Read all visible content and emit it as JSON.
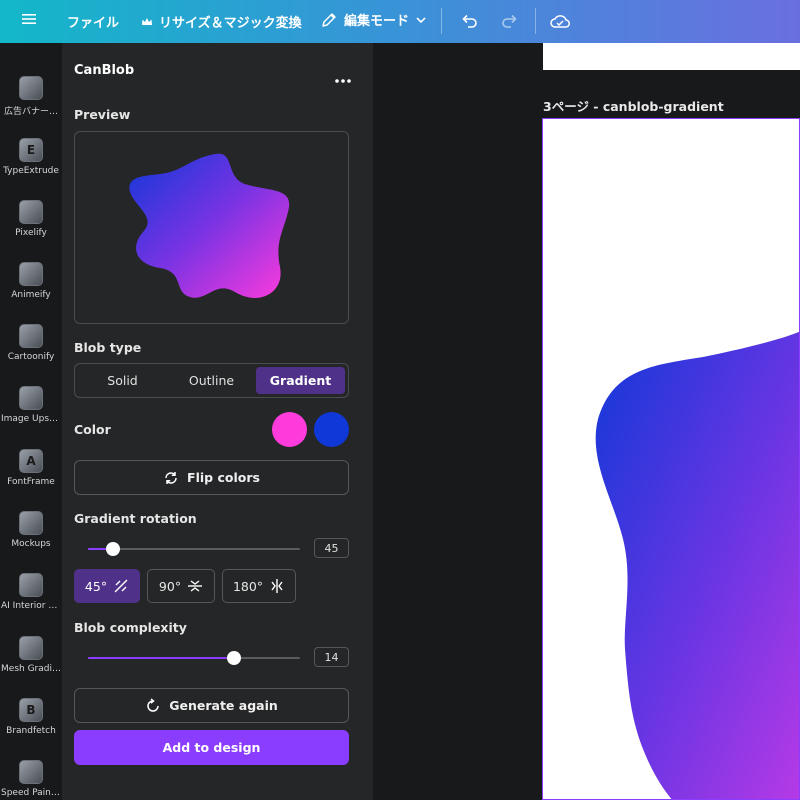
{
  "topbar": {
    "file_label": "ファイル",
    "resize_label": "リサイズ＆マジック変換",
    "edit_mode_label": "編集モード"
  },
  "apps": [
    {
      "label": "広告バナー…",
      "glyph": ""
    },
    {
      "label": "TypeExtrude",
      "glyph": "E"
    },
    {
      "label": "Pixelify",
      "glyph": ""
    },
    {
      "label": "Animeify",
      "glyph": ""
    },
    {
      "label": "Cartoonify",
      "glyph": ""
    },
    {
      "label": "Image Upsc…",
      "glyph": ""
    },
    {
      "label": "FontFrame",
      "glyph": "A"
    },
    {
      "label": "Mockups",
      "glyph": ""
    },
    {
      "label": "AI Interior S…",
      "glyph": ""
    },
    {
      "label": "Mesh Gradi…",
      "glyph": ""
    },
    {
      "label": "Brandfetch",
      "glyph": "B"
    },
    {
      "label": "Speed Paint…",
      "glyph": ""
    }
  ],
  "panel": {
    "title": "CanBlob",
    "preview_label": "Preview",
    "blob_type_label": "Blob type",
    "blob_types": [
      "Solid",
      "Outline",
      "Gradient"
    ],
    "blob_type_selected": "Gradient",
    "color_label": "Color",
    "flip_colors_label": "Flip colors",
    "gradient_rotation_label": "Gradient rotation",
    "gradient_rotation_value": "45",
    "gradient_rotation_fraction": 0.12,
    "rotation_presets": [
      "45°",
      "90°",
      "180°"
    ],
    "rotation_selected": "45°",
    "blob_complexity_label": "Blob complexity",
    "blob_complexity_value": "14",
    "blob_complexity_fraction": 0.69,
    "generate_again_label": "Generate again",
    "add_to_design_label": "Add to design"
  },
  "colors": {
    "gradient_start": "#ff3bdc",
    "gradient_end": "#1038d8",
    "accent": "#8b3dff",
    "selected": "#4f3189"
  },
  "canvas": {
    "page_label": "3ページ - canblob-gradient"
  }
}
